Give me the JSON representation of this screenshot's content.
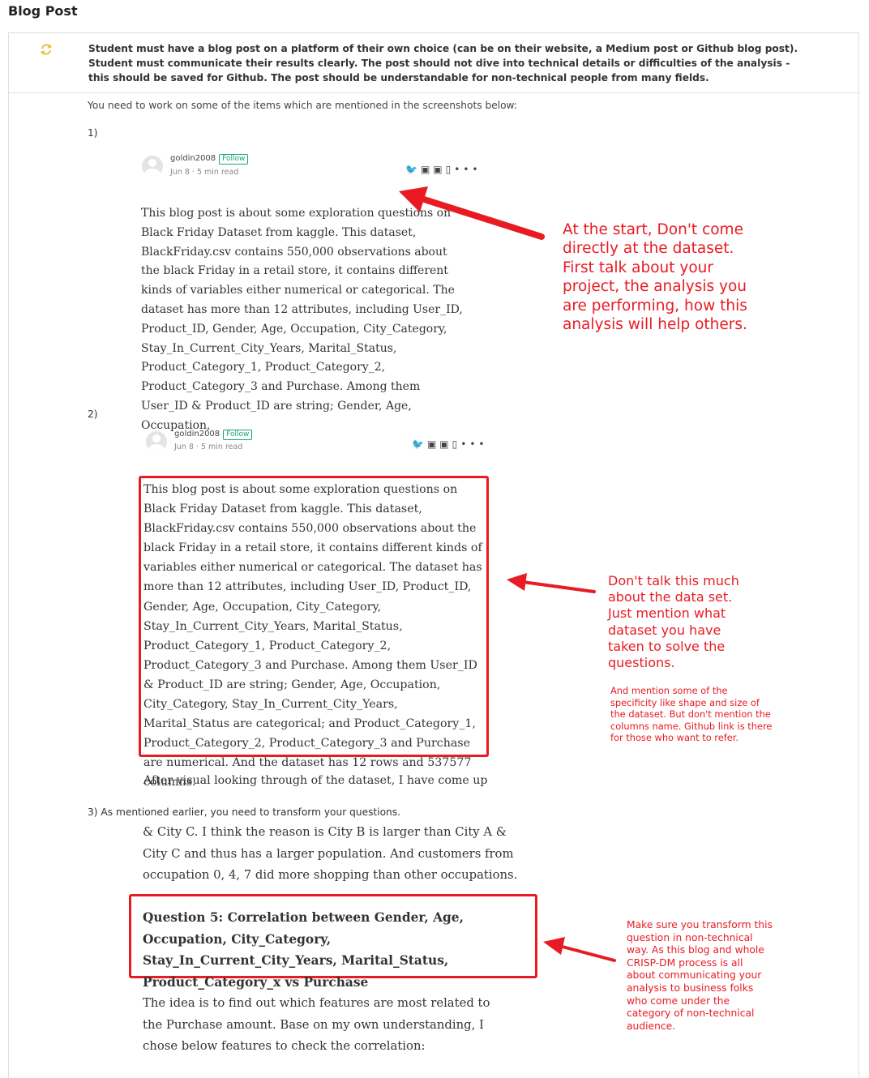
{
  "section": {
    "title": "Blog Post"
  },
  "criteria": {
    "text": "Student must have a blog post on a platform of their own choice (can be on their website, a Medium post or Github blog post). Student must communicate their results clearly. The post should not dive into technical details or difficulties of the analysis - this should be saved for Github. The post should be understandable for non-technical people from many fields.",
    "status_icon": "refresh-icon",
    "status_color": "#e8c43a"
  },
  "review": {
    "intro": "You need to work on some of the items which are mentioned in the screenshots below:",
    "item1": {
      "number": "1)",
      "author": "goldin2008",
      "follow": "Follow",
      "meta": "Jun 8 · 5 min read",
      "body": "This blog post is about some exploration questions on Black Friday Dataset from kaggle. This dataset, BlackFriday.csv contains 550,000 observations about the black Friday in a retail store, it contains different kinds of variables either numerical or categorical. The dataset has more than 12 attributes, including User_ID, Product_ID, Gender, Age, Occupation, City_Category, Stay_In_Current_City_Years, Marital_Status, Product_Category_1, Product_Category_2, Product_Category_3 and Purchase. Among them User_ID & Product_ID are string; Gender, Age, Occupation,",
      "note": "At the start, Don't come directly at the dataset. First talk about your project, the analysis you are performing, how this analysis will help others."
    },
    "item2": {
      "number": "2)",
      "author": "goldin2008",
      "follow": "Follow",
      "meta": "Jun 8 · 5 min read",
      "body": "This blog post is about some exploration questions on Black Friday Dataset from kaggle. This dataset, BlackFriday.csv contains 550,000 observations about the black Friday in a retail store, it contains different kinds of variables either numerical or categorical. The dataset has more than 12 attributes, including User_ID, Product_ID, Gender, Age, Occupation, City_Category, Stay_In_Current_City_Years, Marital_Status, Product_Category_1, Product_Category_2, Product_Category_3 and Purchase. Among them User_ID & Product_ID are string; Gender, Age, Occupation, City_Category, Stay_In_Current_City_Years, Marital_Status are categorical; and Product_Category_1, Product_Category_2, Product_Category_3 and Purchase are numerical. And the dataset has 12 rows and 537577 columns.",
      "after": "After visual looking through of the dataset, I have come up",
      "note": "Don't talk this much about the data set. Just mention what dataset you have taken to solve the questions.",
      "note_small": "And mention some of the specificity like shape and size of the dataset. But don't mention the columns name. Github link is there for those who want to refer."
    },
    "item3": {
      "label": "3) As mentioned earlier, you need to transform your questions.",
      "pre": "& City C. I think the reason is City B is larger than City A & City C and thus has a larger population. And customers from occupation 0, 4, 7 did more shopping than other occupations.",
      "question": "Question 5: Correlation between Gender, Age, Occupation, City_Category, Stay_In_Current_City_Years, Marital_Status, Product_Category_x vs Purchase",
      "after": "The idea is to find out which features are most related to the Purchase amount. Base on my own understanding, I chose below features to check the correlation:",
      "note": "Make sure you transform this question in non-technical way. As this blog and whole CRISP-DM process is all about communicating your analysis to business folks who come under the category of non-technical audience."
    }
  },
  "colors": {
    "annotation_red": "#e81b23",
    "follow_green": "#1aa56f"
  }
}
